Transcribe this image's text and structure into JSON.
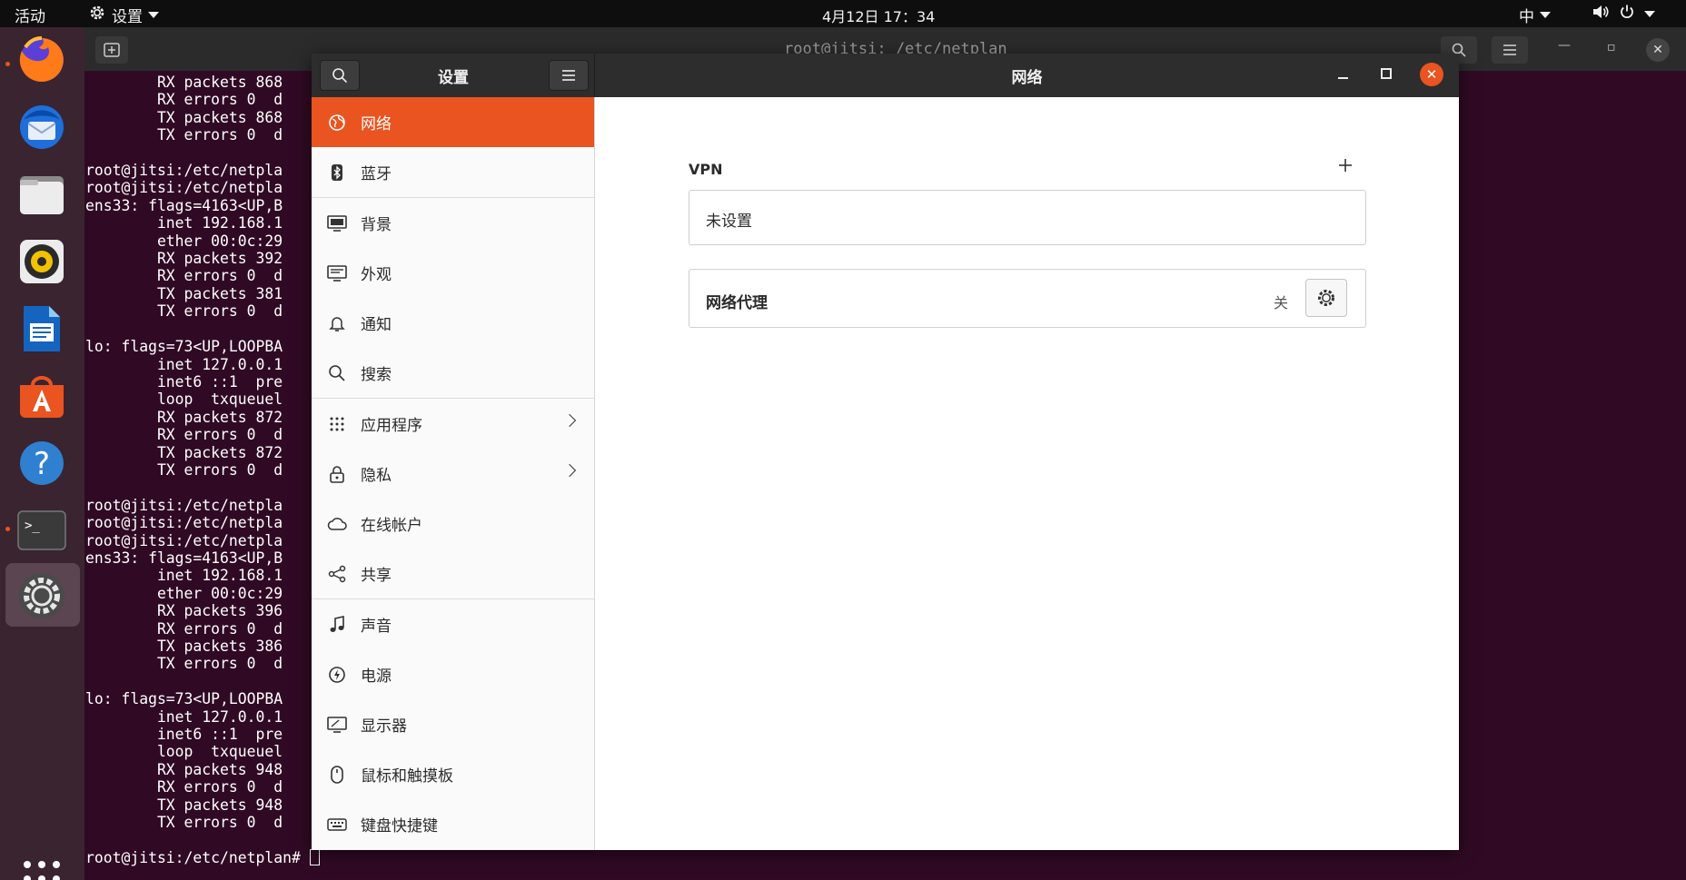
{
  "topbar": {
    "activities": "活动",
    "app_name": "设置",
    "clock": "4月12日  17：34",
    "input_method": "中"
  },
  "dock": {
    "items": [
      "firefox-icon",
      "thunderbird-icon",
      "files-icon",
      "rhythmbox-icon",
      "writer-icon",
      "software-icon",
      "help-icon",
      "terminal-icon",
      "settings-icon"
    ],
    "running_indicator_color": "#e95420"
  },
  "terminal": {
    "title": "root@jitsi: /etc/netplan",
    "lines": [
      "        RX packets 868",
      "        RX errors 0  d",
      "        TX packets 868",
      "        TX errors 0  d",
      "",
      "root@jitsi:/etc/netpla",
      "root@jitsi:/etc/netpla",
      "ens33: flags=4163<UP,B",
      "        inet 192.168.1",
      "        ether 00:0c:29",
      "        RX packets 392",
      "        RX errors 0  d",
      "        TX packets 381",
      "        TX errors 0  d",
      "",
      "lo: flags=73<UP,LOOPBA",
      "        inet 127.0.0.1",
      "        inet6 ::1  pre",
      "        loop  txqueuel",
      "        RX packets 872",
      "        RX errors 0  d",
      "        TX packets 872",
      "        TX errors 0  d",
      "",
      "root@jitsi:/etc/netpla",
      "root@jitsi:/etc/netpla",
      "root@jitsi:/etc/netpla",
      "ens33: flags=4163<UP,B",
      "        inet 192.168.1",
      "        ether 00:0c:29",
      "        RX packets 396",
      "        RX errors 0  d",
      "        TX packets 386",
      "        TX errors 0  d",
      "",
      "lo: flags=73<UP,LOOPBA",
      "        inet 127.0.0.1",
      "        inet6 ::1  pre",
      "        loop  txqueuel",
      "        RX packets 948",
      "        RX errors 0  d",
      "        TX packets 948",
      "        TX errors 0  d",
      ""
    ],
    "prompt": "root@jitsi:/etc/netplan# "
  },
  "settings": {
    "sidebar_title": "设置",
    "panel_title": "网络",
    "accent_color": "#e95420",
    "items": [
      {
        "label": "网络",
        "icon": "network-icon"
      },
      {
        "label": "蓝牙",
        "icon": "bluetooth-icon"
      },
      {
        "label": "背景",
        "icon": "background-icon"
      },
      {
        "label": "外观",
        "icon": "appearance-icon"
      },
      {
        "label": "通知",
        "icon": "bell-icon"
      },
      {
        "label": "搜索",
        "icon": "search-icon"
      },
      {
        "label": "应用程序",
        "icon": "apps-grid-icon"
      },
      {
        "label": "隐私",
        "icon": "lock-icon"
      },
      {
        "label": "在线帐户",
        "icon": "cloud-icon"
      },
      {
        "label": "共享",
        "icon": "share-icon"
      },
      {
        "label": "声音",
        "icon": "music-note-icon"
      },
      {
        "label": "电源",
        "icon": "power-icon"
      },
      {
        "label": "显示器",
        "icon": "display-icon"
      },
      {
        "label": "鼠标和触摸板",
        "icon": "mouse-icon"
      },
      {
        "label": "键盘快捷键",
        "icon": "keyboard-icon"
      }
    ],
    "vpn": {
      "label": "VPN",
      "empty_text": "未设置"
    },
    "proxy": {
      "label": "网络代理",
      "state": "关"
    }
  }
}
